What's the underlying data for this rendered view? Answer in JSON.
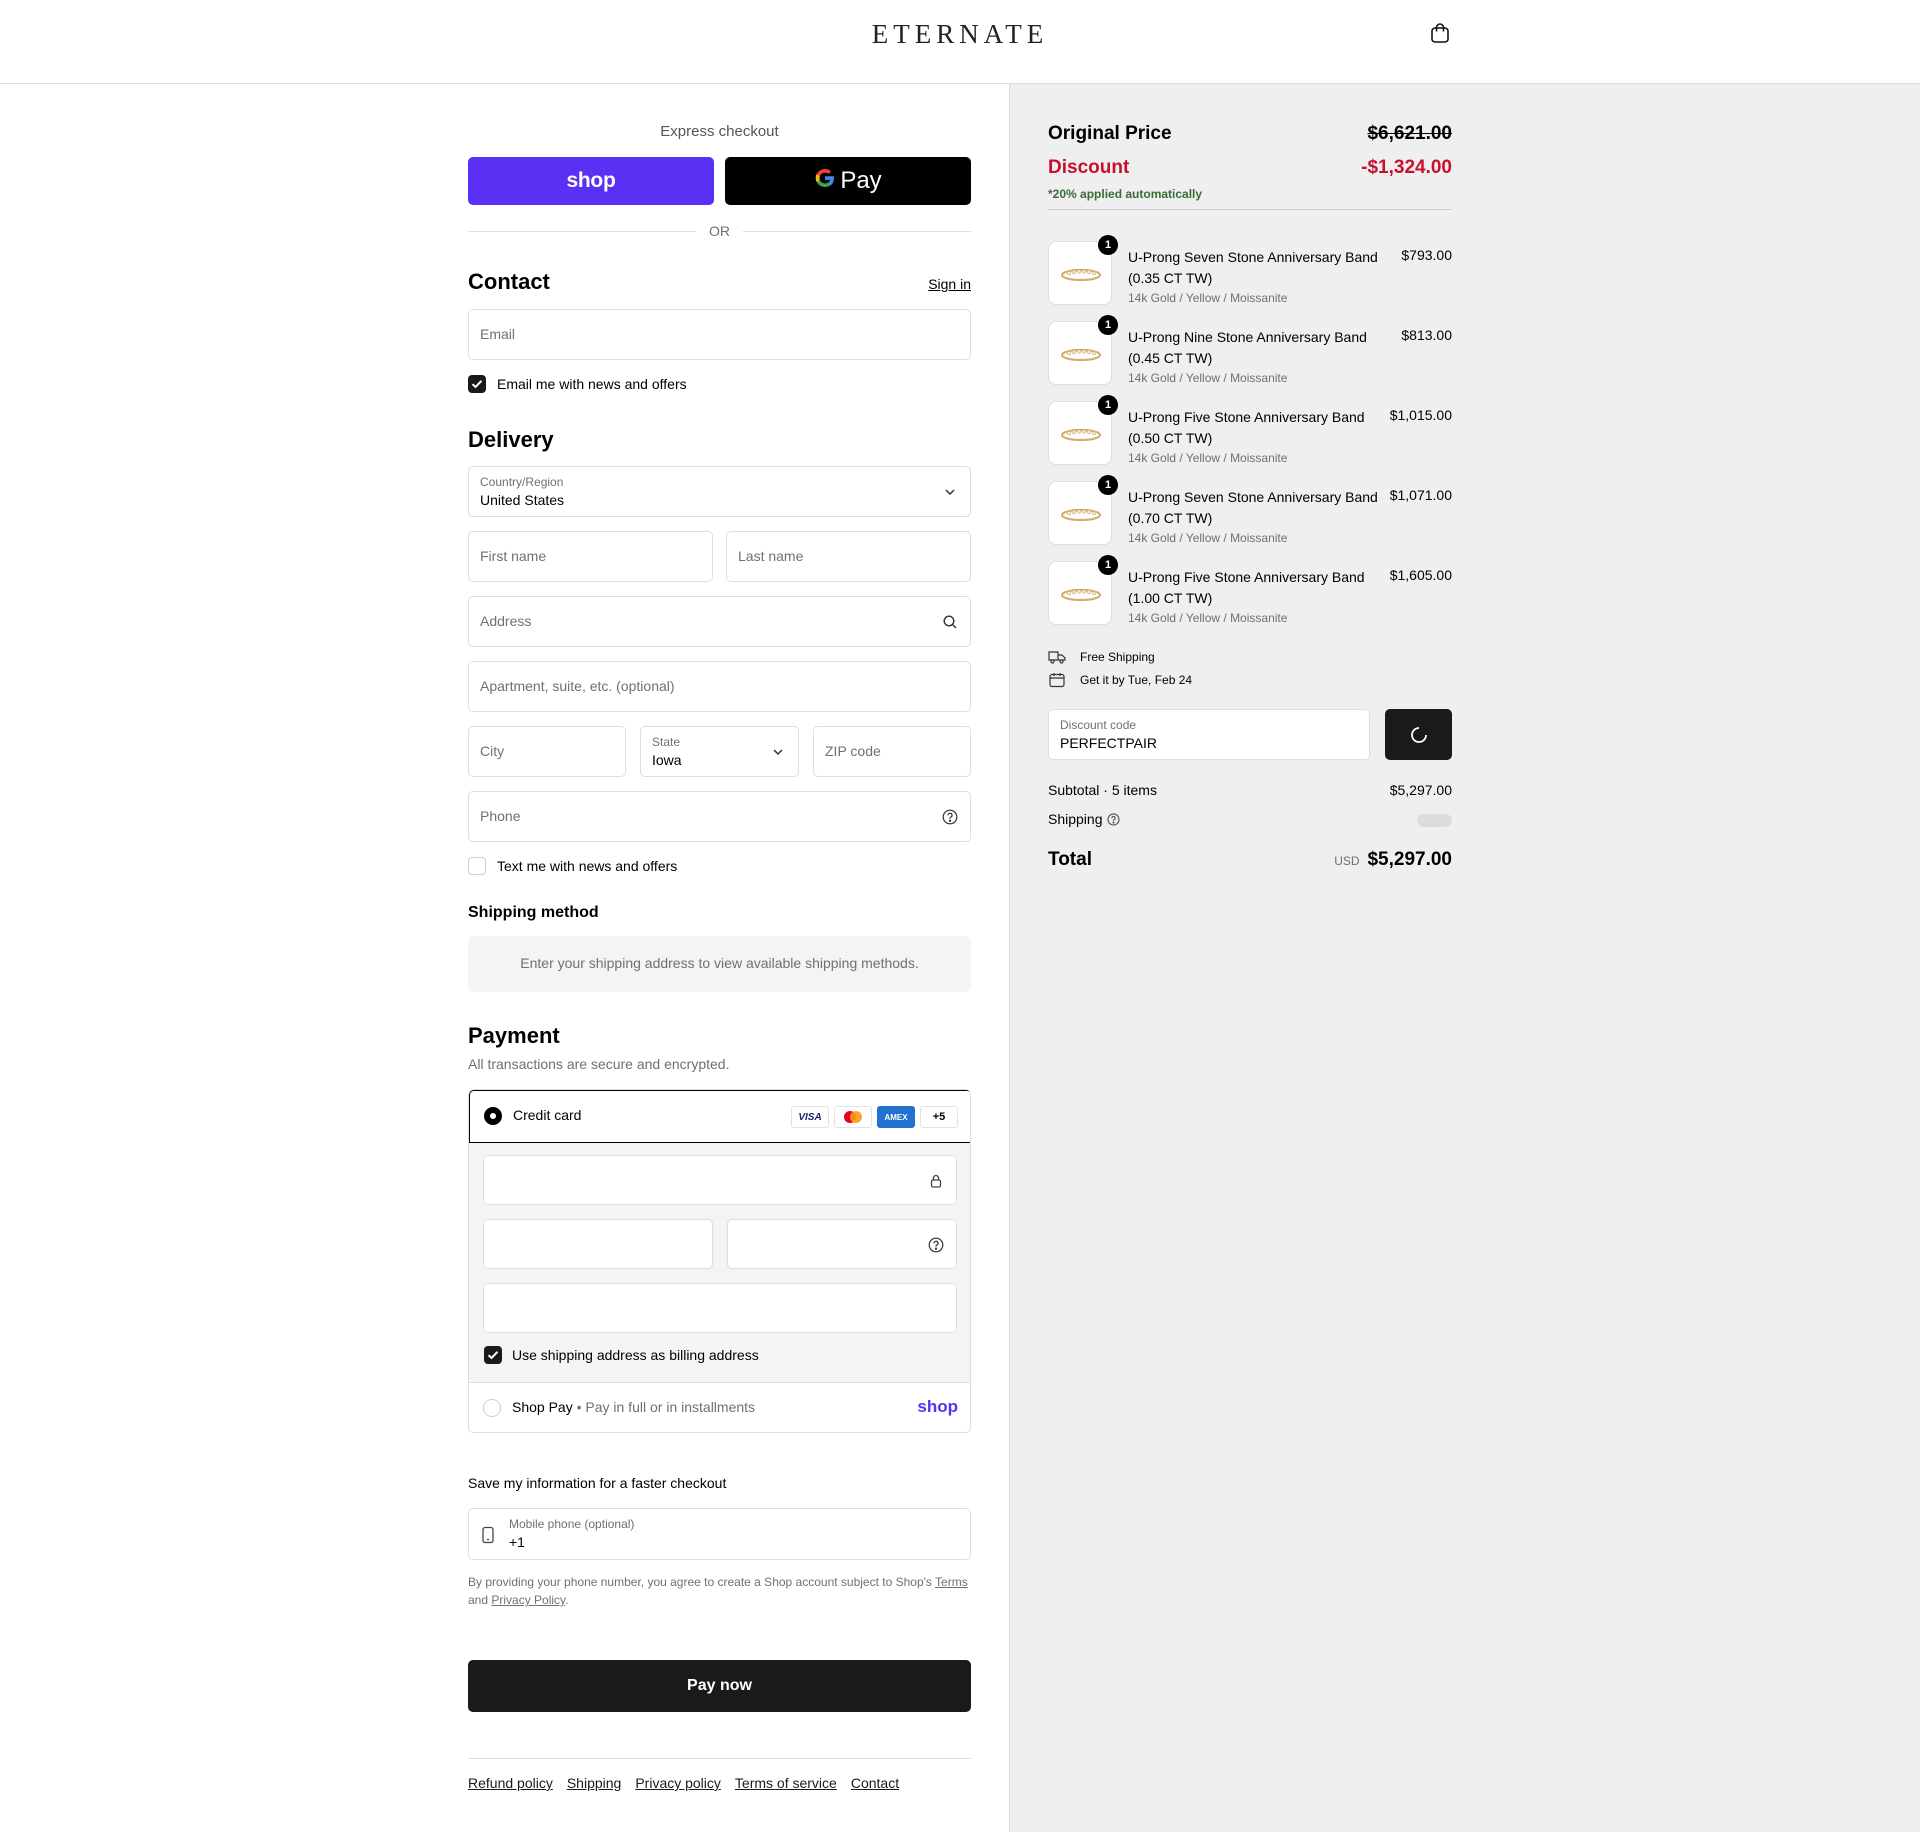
{
  "header": {
    "logo": "ETERNATE",
    "cart_icon": "shopping-bag-icon"
  },
  "express": {
    "label": "Express checkout",
    "shop_pay": "shop",
    "google_pay": "Pay",
    "or": "OR"
  },
  "contact": {
    "title": "Contact",
    "sign_in": "Sign in",
    "email_placeholder": "Email",
    "newsletter_label": "Email me with news and offers",
    "newsletter_checked": true
  },
  "delivery": {
    "title": "Delivery",
    "country_label": "Country/Region",
    "country_value": "United States",
    "first_name": "First name",
    "last_name": "Last name",
    "address": "Address",
    "apartment": "Apartment, suite, etc. (optional)",
    "city": "City",
    "state_label": "State",
    "state_value": "Iowa",
    "zip": "ZIP code",
    "phone": "Phone",
    "sms_label": "Text me with news and offers",
    "sms_checked": false
  },
  "shipping_method": {
    "title": "Shipping method",
    "info": "Enter your shipping address to view available shipping methods."
  },
  "payment": {
    "title": "Payment",
    "subtitle": "All transactions are secure and encrypted.",
    "credit_card_label": "Credit card",
    "card_brands": [
      "VISA",
      "Mastercard",
      "AMEX"
    ],
    "more_brands": "+5",
    "billing_label": "Use shipping address as billing address",
    "billing_checked": true,
    "shop_pay_label": "Shop Pay",
    "shop_pay_sub": "Pay in full or in installments",
    "shop_pay_logo": "shop"
  },
  "save_info": {
    "title": "Save my information for a faster checkout",
    "mobile_label": "Mobile phone (optional)",
    "mobile_value": "+1",
    "disclaimer_pre": "By providing your phone number, you agree to create a Shop account subject to Shop's",
    "terms": "Terms",
    "and": "and",
    "privacy": "Privacy Policy"
  },
  "pay_now": "Pay now",
  "footer": [
    "Refund policy",
    "Shipping",
    "Privacy policy",
    "Terms of service",
    "Contact"
  ],
  "summary": {
    "original_price_label": "Original Price",
    "original_price": "$6,621.00",
    "discount_label": "Discount",
    "discount": "-$1,324.00",
    "discount_note": "*20% applied automatically",
    "items": [
      {
        "qty": "1",
        "name": "U-Prong Seven Stone Anniversary Band (0.35 CT TW)",
        "variant": "14k Gold / Yellow / Moissanite",
        "price": "$793.00"
      },
      {
        "qty": "1",
        "name": "U-Prong Nine Stone Anniversary Band (0.45 CT TW)",
        "variant": "14k Gold / Yellow / Moissanite",
        "price": "$813.00"
      },
      {
        "qty": "1",
        "name": "U-Prong Five Stone Anniversary Band (0.50 CT TW)",
        "variant": "14k Gold / Yellow / Moissanite",
        "price": "$1,015.00"
      },
      {
        "qty": "1",
        "name": "U-Prong Seven Stone Anniversary Band (0.70 CT TW)",
        "variant": "14k Gold / Yellow / Moissanite",
        "price": "$1,071.00"
      },
      {
        "qty": "1",
        "name": "U-Prong Five Stone Anniversary Band (1.00 CT TW)",
        "variant": "14k Gold / Yellow / Moissanite",
        "price": "$1,605.00"
      }
    ],
    "free_shipping": "Free Shipping",
    "delivery_date": "Get it by Tue, Feb 24",
    "discount_code_label": "Discount code",
    "discount_code_value": "PERFECTPAIR",
    "subtotal_label": "Subtotal · 5 items",
    "subtotal": "$5,297.00",
    "shipping_label": "Shipping",
    "total_label": "Total",
    "currency": "USD",
    "total": "$5,297.00"
  },
  "colors": {
    "shop_purple": "#5a31f4",
    "discount_red": "#c8102e",
    "note_green": "#3a6b35",
    "panel_bg": "#efefef"
  }
}
